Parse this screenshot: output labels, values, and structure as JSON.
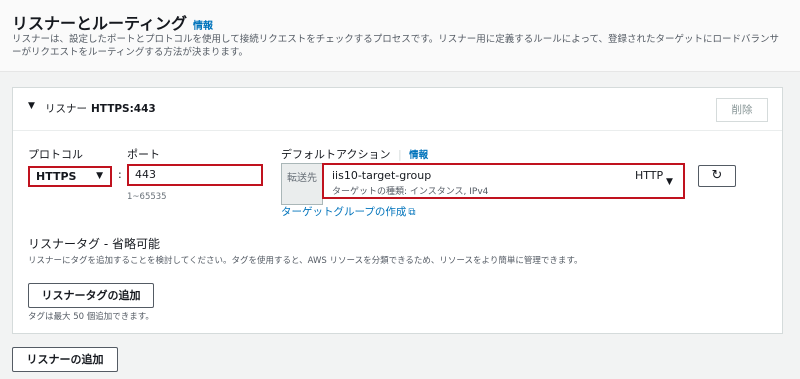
{
  "header": {
    "title": "リスナーとルーティング",
    "info": "情報",
    "description": "リスナーは、設定したポートとプロトコルを使用して接続リクエストをチェックするプロセスです。リスナー用に定義するルールによって、登録されたターゲットにロードバランサーがリクエストをルーティングする方法が決まります。"
  },
  "listener": {
    "label": "リスナー",
    "value": "HTTPS:443",
    "delete_label": "削除",
    "protocol_label": "プロトコル",
    "protocol_value": "HTTPS",
    "separator": ":",
    "port_label": "ポート",
    "port_value": "443",
    "port_hint": "1~65535",
    "default_action_label": "デフォルトアクション",
    "default_action_info": "情報",
    "forward_label": "転送先",
    "target_group_name": "iis10-target-group",
    "target_group_type": "ターゲットの種類: インスタンス, IPv4",
    "target_group_protocol": "HTTP",
    "create_target_group_link": "ターゲットグループの作成",
    "tags_title": "リスナータグ - 省略可能",
    "tags_description": "リスナーにタグを追加することを検討してください。タグを使用すると、AWS リソースを分類できるため、リソースをより簡単に管理できます。",
    "add_tag_label": "リスナータグの追加",
    "tag_limit": "タグは最大 50 個追加できます。"
  },
  "footer": {
    "add_listener_label": "リスナーの追加"
  },
  "icons": {
    "caret": "caret-down-icon",
    "dropdown": "dropdown-arrow-icon",
    "refresh": "refresh-icon",
    "external": "external-link-icon"
  },
  "colors": {
    "link": "#0073bb",
    "highlight_border": "#c0121e"
  }
}
